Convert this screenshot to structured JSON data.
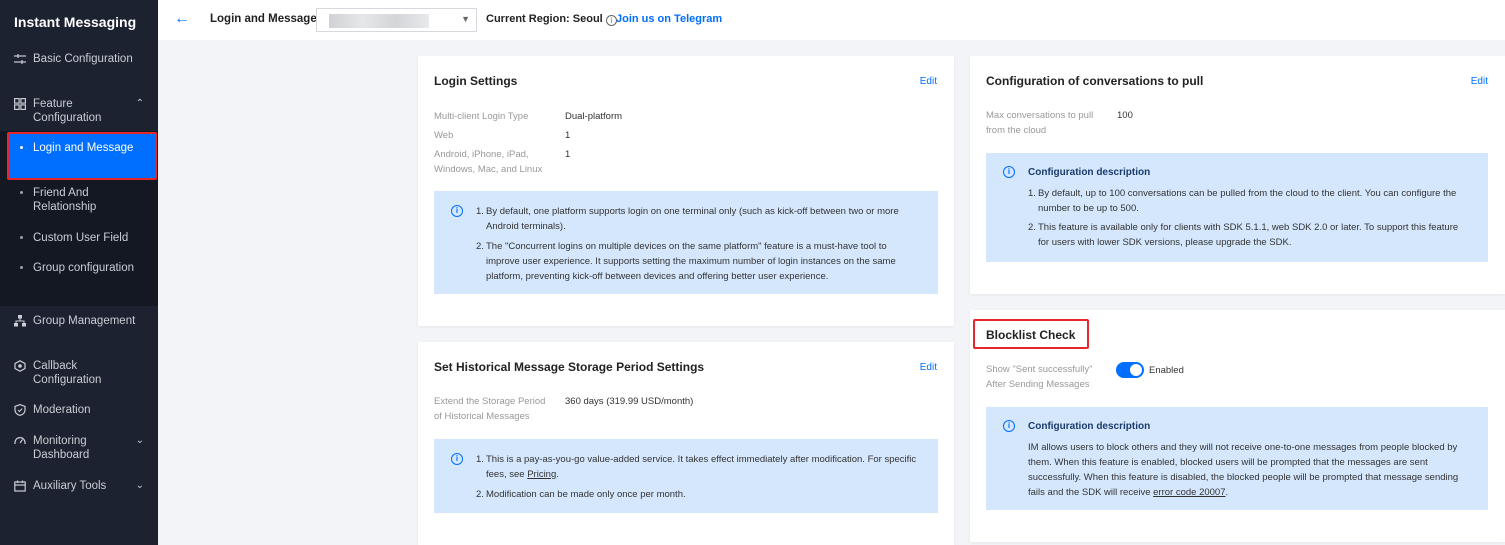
{
  "sidebar": {
    "title": "Instant Messaging",
    "items": [
      {
        "label": "Basic Configuration",
        "icon": "sliders-icon"
      },
      {
        "label": "Feature Configuration",
        "icon": "grid-icon",
        "expanded": true
      },
      {
        "label": "Group Management",
        "icon": "hierarchy-icon"
      },
      {
        "label": "Callback Configuration",
        "icon": "callback-icon"
      },
      {
        "label": "Moderation",
        "icon": "shield-icon"
      },
      {
        "label": "Monitoring Dashboard",
        "icon": "dashboard-icon",
        "expanded": false
      },
      {
        "label": "Auxiliary Tools",
        "icon": "tools-icon",
        "expanded": false
      }
    ],
    "subitems": [
      {
        "label": "Login and Message",
        "active": true
      },
      {
        "label": "Friend And Relationship"
      },
      {
        "label": "Custom User Field"
      },
      {
        "label": "Group configuration"
      }
    ]
  },
  "topbar": {
    "title": "Login and Message",
    "region_label": "Current Region: Seoul",
    "telegram_link": "Join us on Telegram"
  },
  "login_settings": {
    "title": "Login Settings",
    "edit": "Edit",
    "rows": [
      {
        "key": "Multi-client Login Type",
        "value": "Dual-platform"
      },
      {
        "key": "Web",
        "value": "1"
      },
      {
        "key": "Android, iPhone, iPad, Windows, Mac, and Linux",
        "value": "1"
      }
    ],
    "notes": [
      "By default, one platform supports login on one terminal only (such as kick-off between two or more Android terminals).",
      "The \"Concurrent logins on multiple devices on the same platform\" feature is a must-have tool to improve user experience. It supports setting the maximum number of login instances on the same platform, preventing kick-off between devices and offering better user experience."
    ]
  },
  "history_settings": {
    "title": "Set Historical Message Storage Period Settings",
    "edit": "Edit",
    "key": "Extend the Storage Period of Historical Messages",
    "value": "360 days (319.99 USD/month)",
    "note1_pre": "This is a pay-as-you-go value-added service. It takes effect immediately after modification. For specific fees, see ",
    "note1_link": "Pricing",
    "note1_post": ".",
    "note2": "Modification can be made only once per month."
  },
  "conversations": {
    "title": "Configuration of conversations to pull",
    "edit": "Edit",
    "key": "Max conversations to pull from the cloud",
    "value": "100",
    "desc_title": "Configuration description",
    "notes": [
      "By default, up to 100 conversations can be pulled from the cloud to the client. You can configure the number to be up to 500.",
      "This feature is available only for clients with SDK 5.1.1, web SDK 2.0 or later. To support this feature for users with lower SDK versions, please upgrade the SDK."
    ]
  },
  "blocklist": {
    "title": "Blocklist Check",
    "key": "Show \"Sent successfully\" After Sending Messages",
    "toggle_label": "Enabled",
    "desc_title": "Configuration description",
    "desc_pre": "IM allows users to block others and they will not receive one-to-one messages from people blocked by them. When this feature is enabled, blocked users will be prompted that the messages are sent successfully. When this feature is disabled, the blocked people will be prompted that message sending fails and the SDK will receive ",
    "desc_link": "error code 20007",
    "desc_post": "."
  },
  "colors": {
    "accent": "#006eff",
    "sidebar_bg": "#1c2230",
    "highlight": "#e5262b",
    "notice_bg": "#d5e7fd"
  }
}
